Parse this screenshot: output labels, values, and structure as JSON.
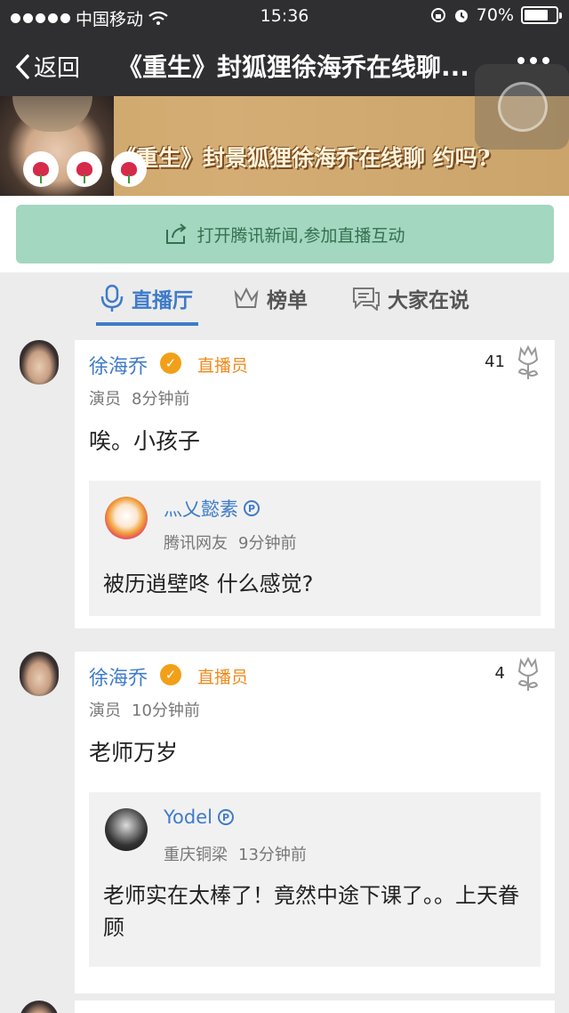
{
  "status_bar": {
    "carrier": "中国移动",
    "time": "15:36",
    "battery": "70%"
  },
  "nav": {
    "back_label": "返回",
    "title": "《重生》封狐狸徐海乔在线聊..."
  },
  "banner": {
    "text": "《重生》封景狐狸徐海乔在线聊  约吗?"
  },
  "open_news": {
    "label": "打开腾讯新闻,参加直播互动"
  },
  "tabs": [
    {
      "label": "直播厅",
      "icon": "mic-icon",
      "active": true
    },
    {
      "label": "榜单",
      "icon": "crown-icon",
      "active": false
    },
    {
      "label": "大家在说",
      "icon": "chat-icon",
      "active": false
    }
  ],
  "posts": [
    {
      "author": "徐海乔",
      "role": "直播员",
      "occupation": "演员",
      "time": "8分钟前",
      "likes": "41",
      "message": "唉。小孩子",
      "quote": {
        "author": "灬乂懿素",
        "location": "腾讯网友",
        "time": "9分钟前",
        "message": "被历逍壁咚 什么感觉?"
      }
    },
    {
      "author": "徐海乔",
      "role": "直播员",
      "occupation": "演员",
      "time": "10分钟前",
      "likes": "4",
      "message": "老师万岁",
      "quote": {
        "author": "Yodel",
        "location": "重庆铜梁",
        "time": "13分钟前",
        "message": "老师实在太棒了！竟然中途下课了。。上天眷顾"
      }
    }
  ],
  "colors": {
    "accent": "#3f7bc9",
    "role": "#f08a1c",
    "nav_bg": "#2f2f31",
    "open_bg": "#a3d7c0"
  }
}
